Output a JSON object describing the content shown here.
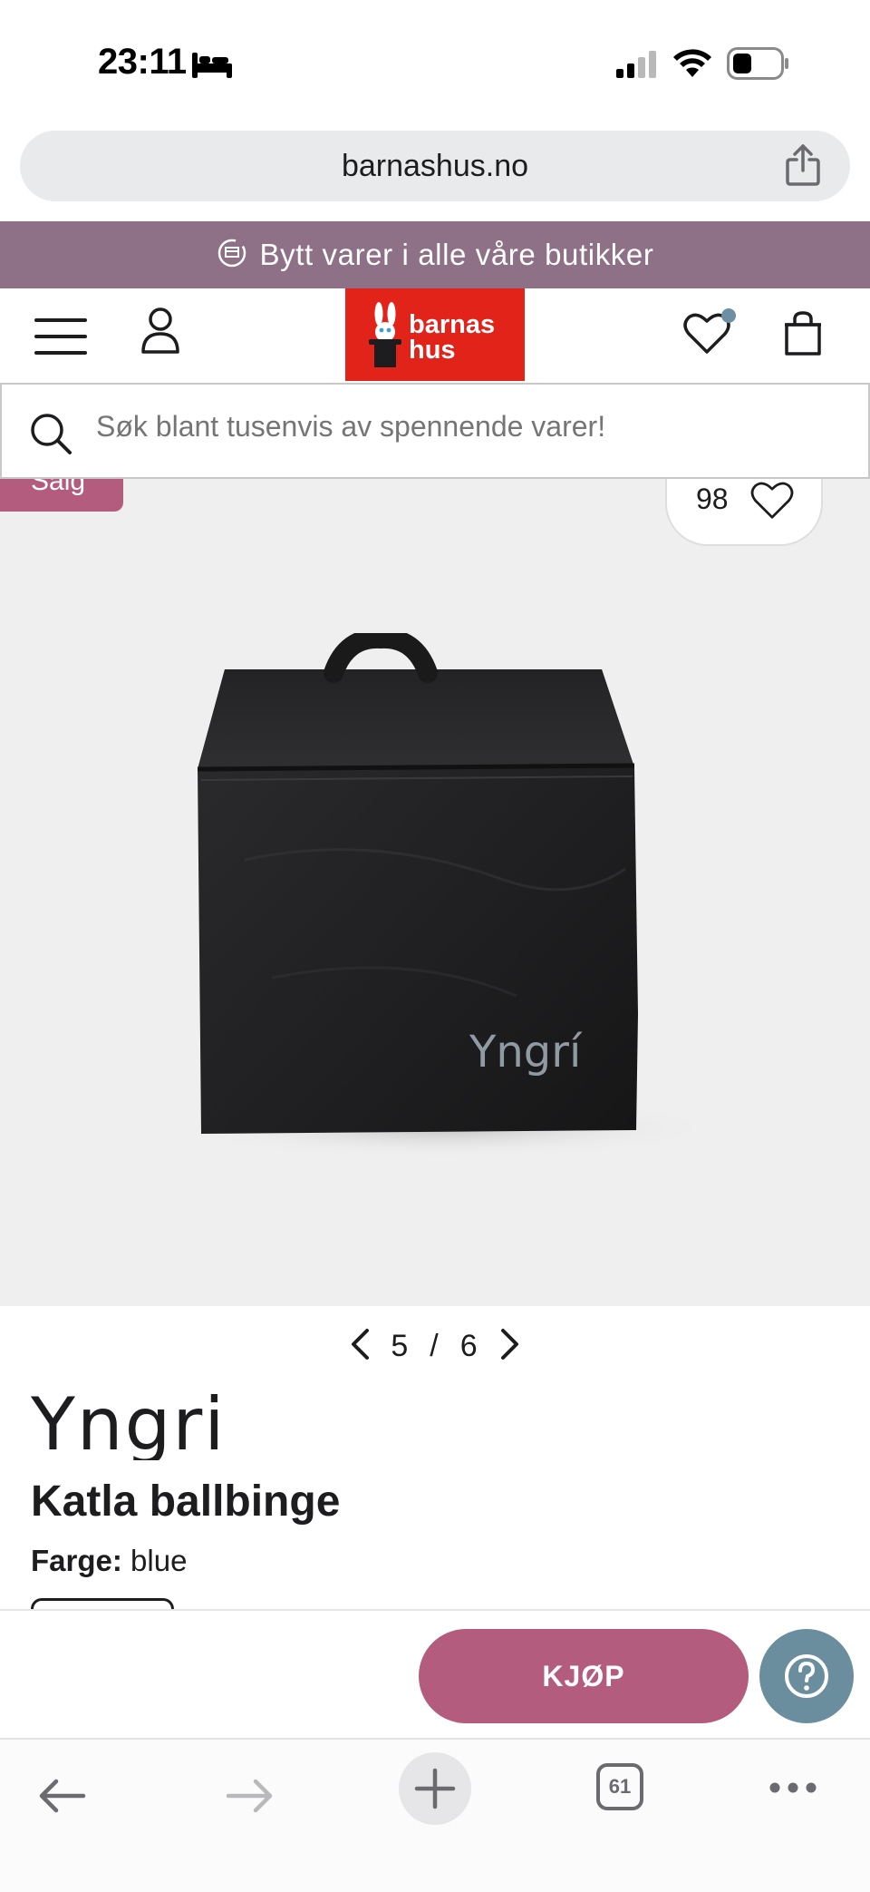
{
  "status_bar": {
    "time": "23:11",
    "icons": [
      "bed-icon",
      "signal-icon",
      "wifi-icon",
      "battery-icon"
    ]
  },
  "browser": {
    "url": "barnashus.no",
    "toolbar": {
      "tabs_count": "61",
      "icons": [
        "back-arrow-icon",
        "forward-arrow-icon",
        "plus-icon",
        "tabs-icon",
        "more-icon"
      ]
    }
  },
  "promo": {
    "text": "Bytt varer i alle våre butikker",
    "icon": "exchange-icon"
  },
  "header": {
    "logo_line1": "barnas",
    "logo_line2": "hus",
    "icons": [
      "menu-icon",
      "account-icon",
      "wishlist-icon",
      "bag-icon"
    ]
  },
  "search": {
    "placeholder": "Søk blant tusenvis av spennende varer!"
  },
  "product": {
    "sale_badge": "Salg",
    "favorites_count": "98",
    "image_brand_text": "Yngrí",
    "pager": {
      "current": "5",
      "separator": "/",
      "total": "6"
    },
    "brand": "Yngri",
    "title": "Katla ballbinge",
    "color_label": "Farge:",
    "color_value": "blue"
  },
  "actions": {
    "buy_label": "KJØP"
  },
  "colors": {
    "promo_bg": "#8e7186",
    "logo_red": "#e2231a",
    "accent_pink": "#b45c7e",
    "help_blue": "#6b8e9e"
  }
}
